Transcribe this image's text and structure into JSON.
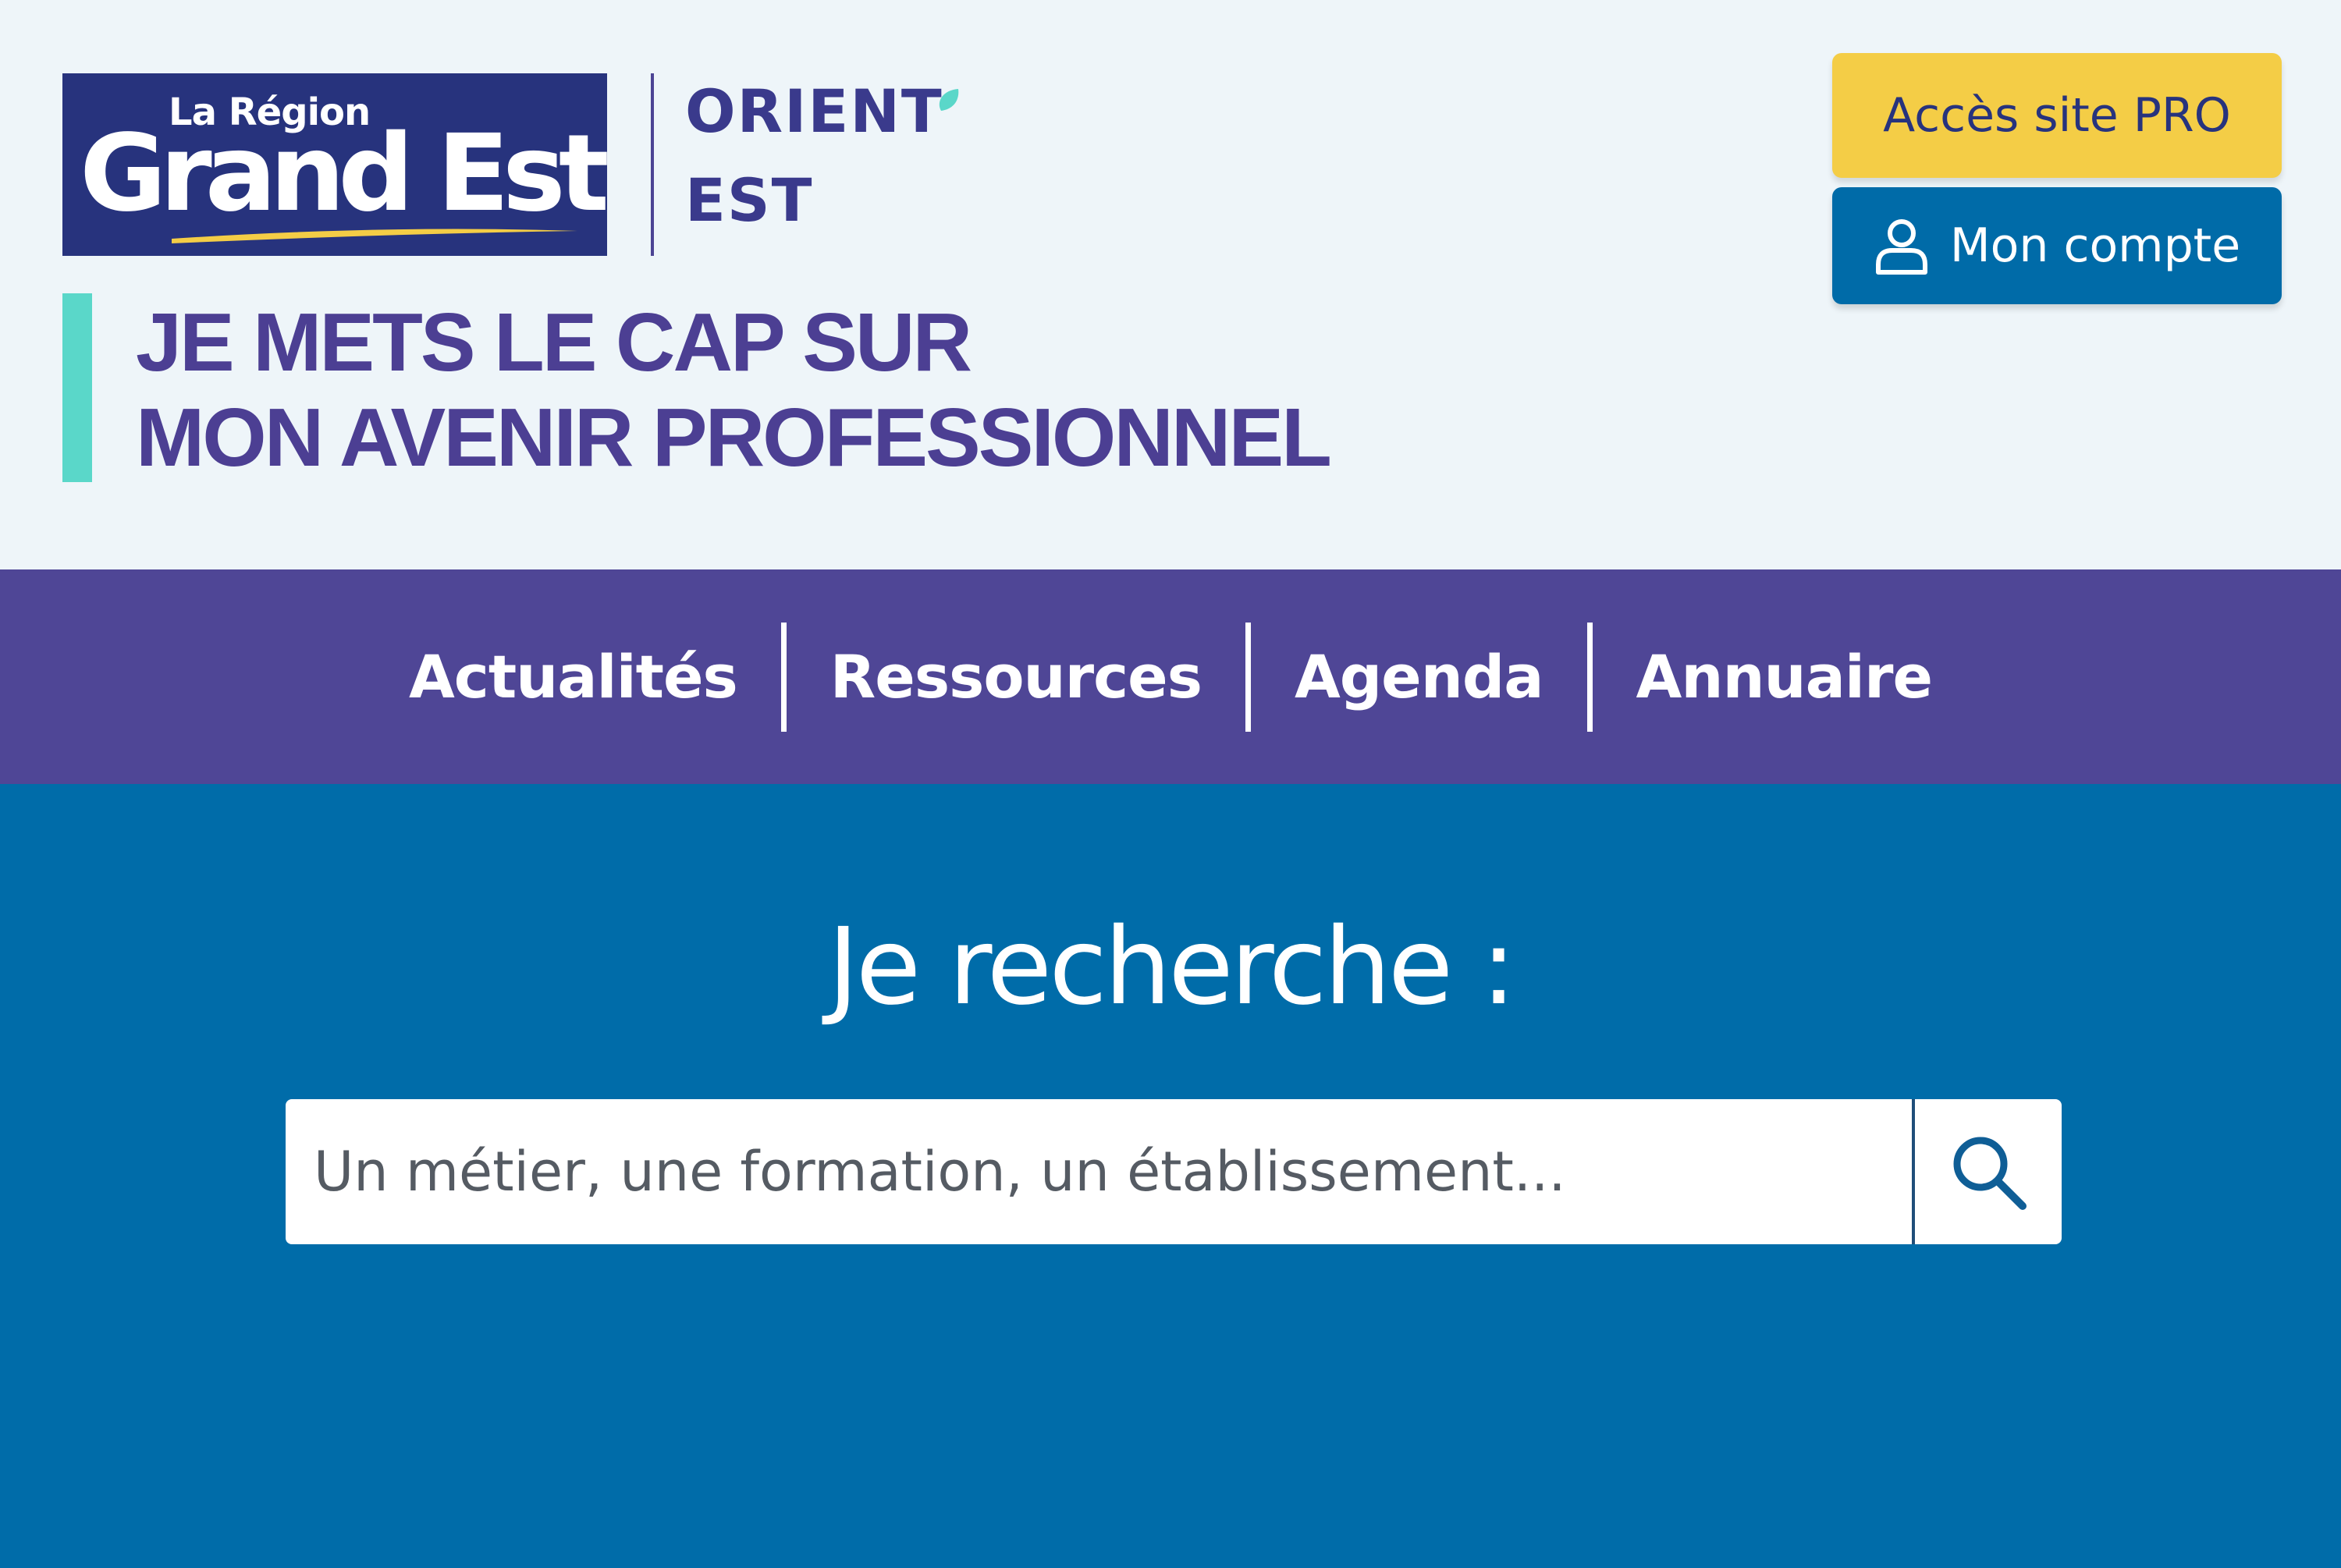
{
  "header": {
    "logo": {
      "line1": "La Région",
      "line2": "Grand Est"
    },
    "brand": {
      "line1": "ORIENT",
      "line2": "EST"
    },
    "tagline": {
      "line1": "JE METS LE CAP SUR",
      "line2": "MON AVENIR PROFESSIONNEL"
    },
    "pro_button_label": "Accès site PRO",
    "account_button_label": "Mon compte",
    "account_icon": "user-icon"
  },
  "nav": {
    "items": [
      {
        "label": "Actualités"
      },
      {
        "label": "Ressources"
      },
      {
        "label": "Agenda"
      },
      {
        "label": "Annuaire"
      }
    ]
  },
  "search": {
    "title": "Je recherche :",
    "placeholder": "Un métier, une formation, un établissement...",
    "value": "",
    "button_icon": "search-icon"
  },
  "colors": {
    "header_bg": "#eef5f9",
    "logo_bg": "#27337d",
    "brand_text": "#3a3a8c",
    "tagline_text": "#4c3f93",
    "accent_teal": "#5ad7c9",
    "pro_button": "#f4cd46",
    "account_button": "#006ba8",
    "nav_bg": "#4f4696",
    "hero_bg": "#006ca9"
  }
}
